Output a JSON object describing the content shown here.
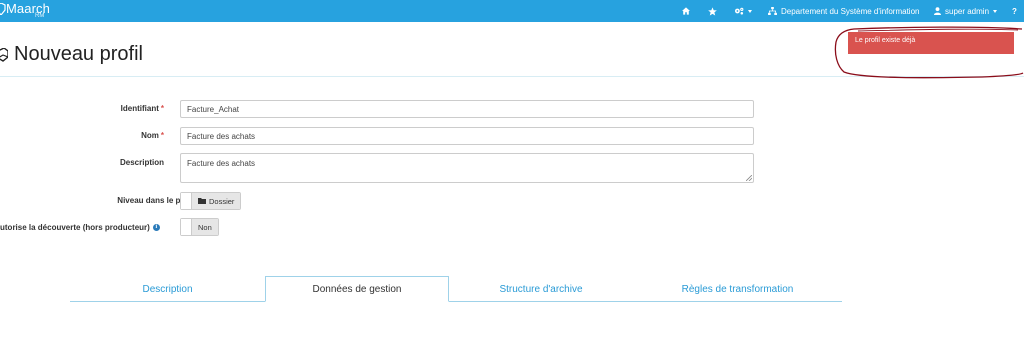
{
  "navbar": {
    "brand_name": "Maarch",
    "brand_sub": "RM",
    "home_icon": "home-icon",
    "favorites_icon": "star-icon",
    "settings_icon": "gears-icon",
    "organization_label": "Departement du Système d'information",
    "user_label": "super admin",
    "help_label": "?",
    "background_color": "#27a2df"
  },
  "page": {
    "title": "Nouveau profil"
  },
  "alert": {
    "message": "Le profil existe déjà",
    "color": "#d9534f"
  },
  "form": {
    "identifier": {
      "label": "Identifiant",
      "required": "*",
      "value": "Facture_Achat"
    },
    "name": {
      "label": "Nom",
      "required": "*",
      "value": "Facture des achats"
    },
    "description": {
      "label": "Description",
      "value": "Facture des achats"
    },
    "plan_level": {
      "label": "Niveau dans le plan",
      "value": "Dossier"
    },
    "discovery": {
      "label": "utorise la découverte (hors producteur)",
      "value": "Non"
    }
  },
  "tabs": [
    {
      "label": "Description"
    },
    {
      "label": "Données de gestion"
    },
    {
      "label": "Structure d'archive"
    },
    {
      "label": "Règles de transformation"
    }
  ]
}
